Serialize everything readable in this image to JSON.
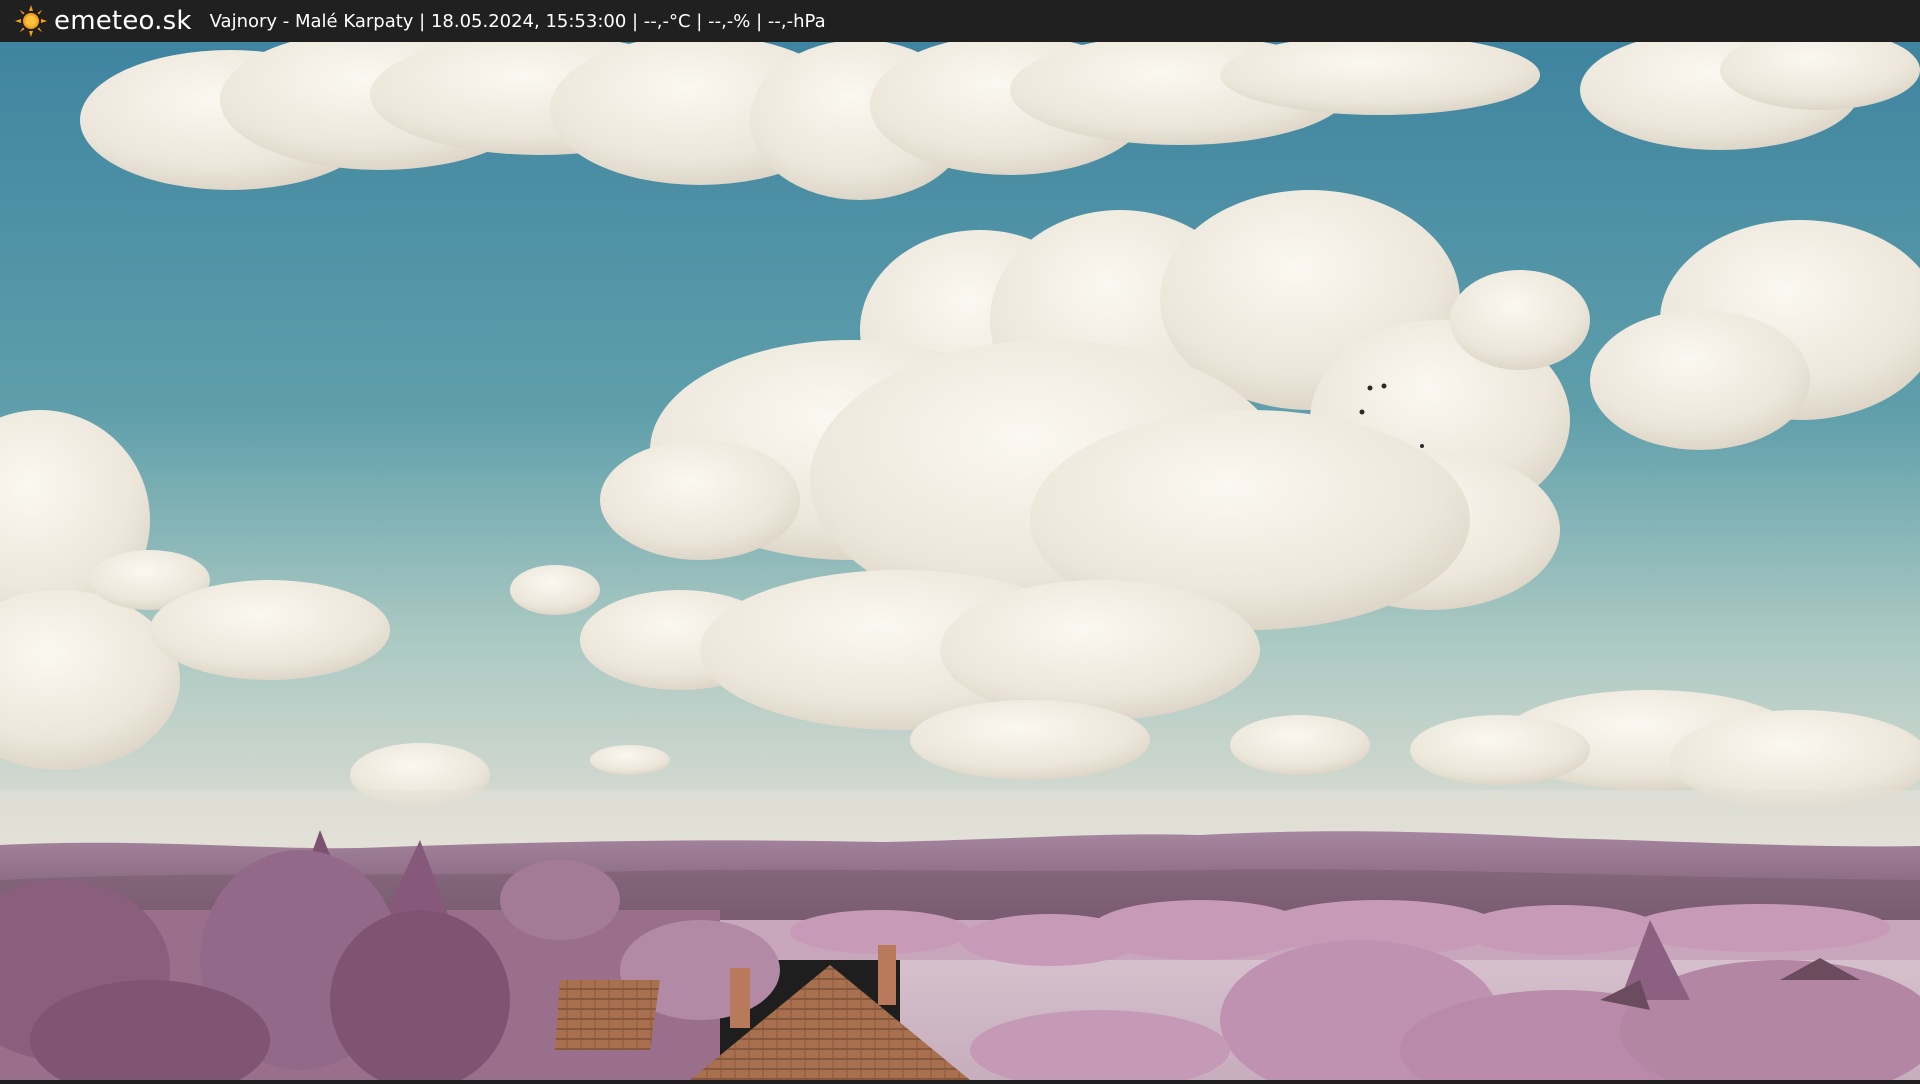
{
  "header": {
    "brand": "emeteo.sk",
    "caption": "Vajnory - Malé Karpaty | 18.05.2024, 15:53:00 | --,-°C | --,-% | --,-hPa",
    "logo_icon": "sun-icon"
  },
  "colors": {
    "bar": "#202020",
    "sky_top": "#4f8fa5",
    "sky_bottom": "#d9ddd2",
    "cloud": "#f1ede4",
    "hills": "#8c6f87",
    "foliage": "#b48aa6",
    "roof": "#a26b4b"
  }
}
